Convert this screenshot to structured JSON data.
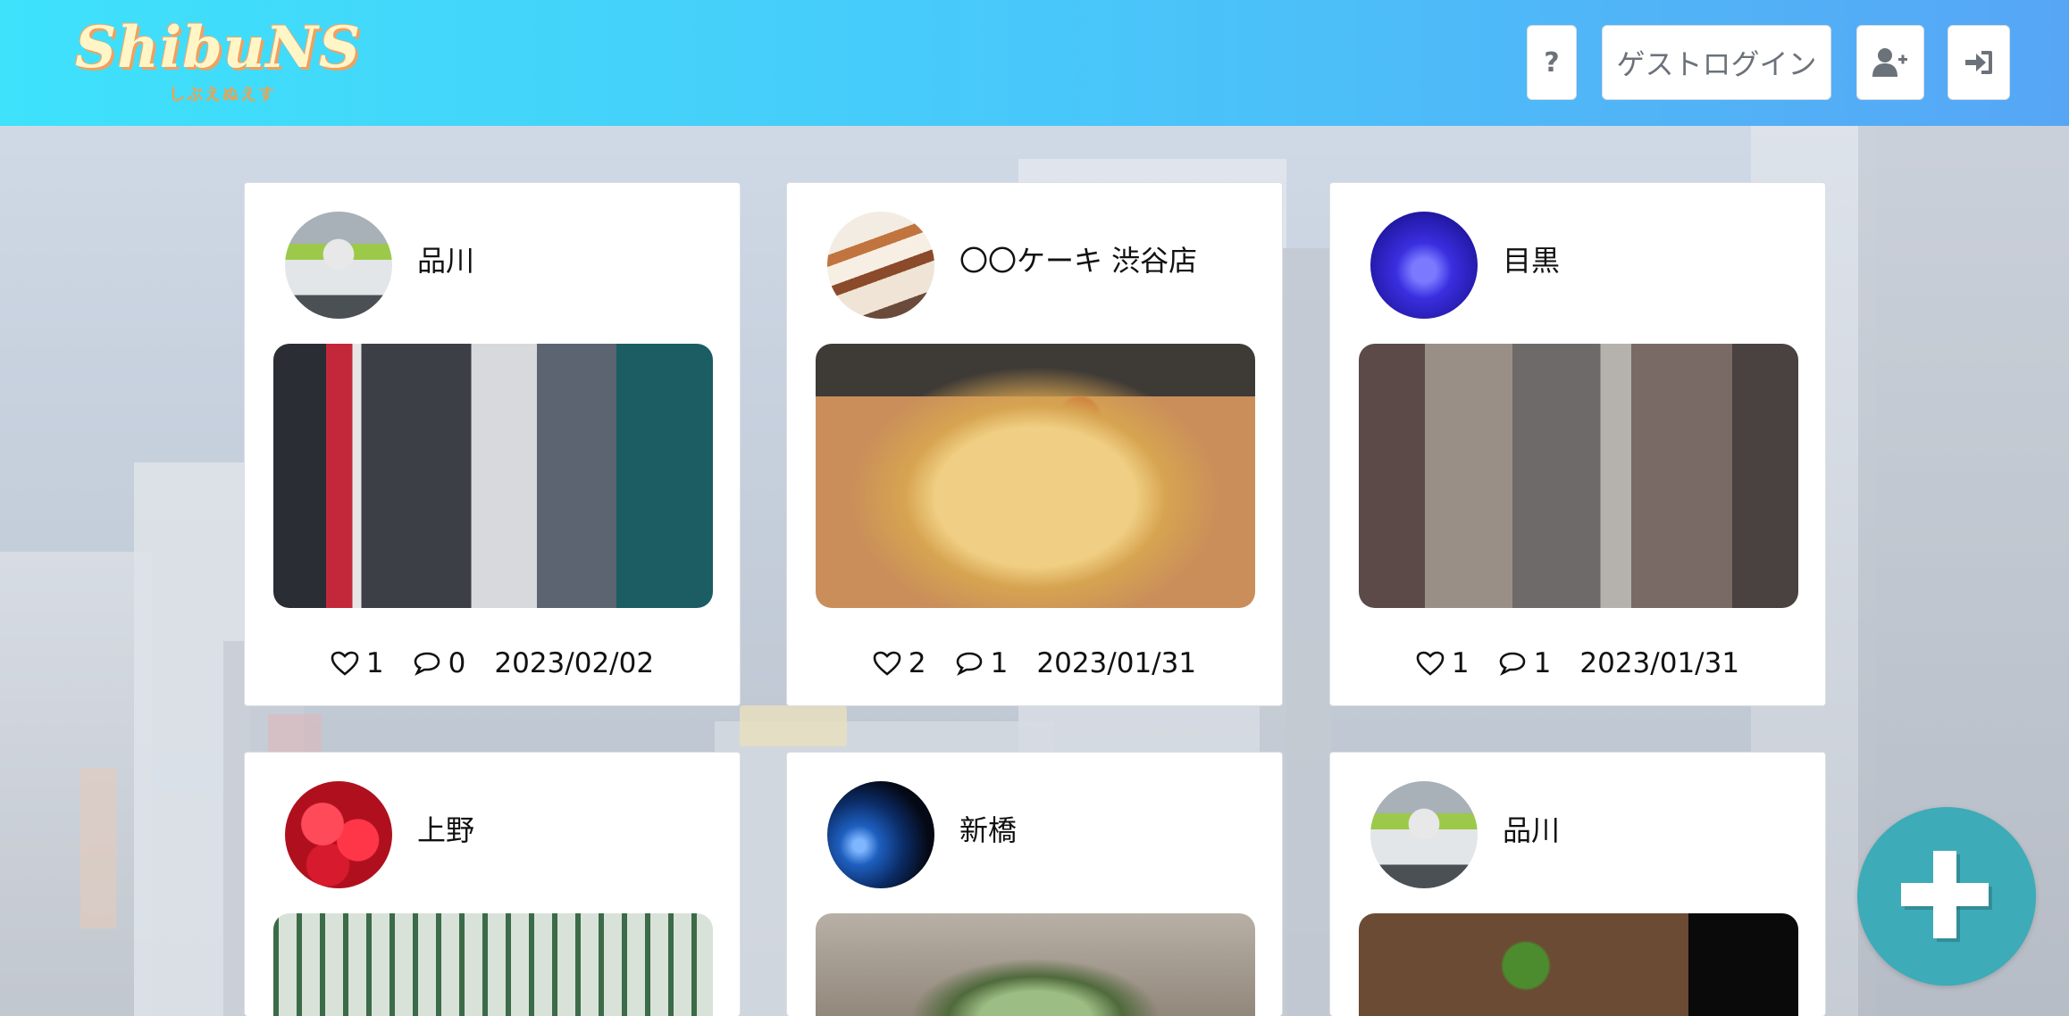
{
  "header": {
    "logo": {
      "title": "ShibuNS",
      "subtitle": "しぶえぬえす"
    },
    "help_label": "?",
    "guest_login_label": "ゲストログイン",
    "signup_icon": "user-plus-icon",
    "login_icon": "sign-in-icon"
  },
  "posts": [
    {
      "title": "品川",
      "avatar": "train",
      "photo": "street",
      "likes": "1",
      "comments": "0",
      "date": "2023/02/02"
    },
    {
      "title": "〇〇ケーキ 渋谷店",
      "avatar": "cake",
      "photo": "crepe",
      "likes": "2",
      "comments": "1",
      "date": "2023/01/31"
    },
    {
      "title": "目黒",
      "avatar": "illumination",
      "photo": "alley",
      "likes": "1",
      "comments": "1",
      "date": "2023/01/31"
    },
    {
      "title": "上野",
      "avatar": "strawberry",
      "photo": "stairs"
    },
    {
      "title": "新橋",
      "avatar": "earth",
      "photo": "tunnel"
    },
    {
      "title": "品川",
      "avatar": "train",
      "photo": "cafe"
    }
  ],
  "fab": {
    "icon": "plus-icon"
  },
  "colors": {
    "header_gradient_start": "#3ee2fb",
    "header_gradient_end": "#56a6f5",
    "fab": "#3dabb8"
  }
}
